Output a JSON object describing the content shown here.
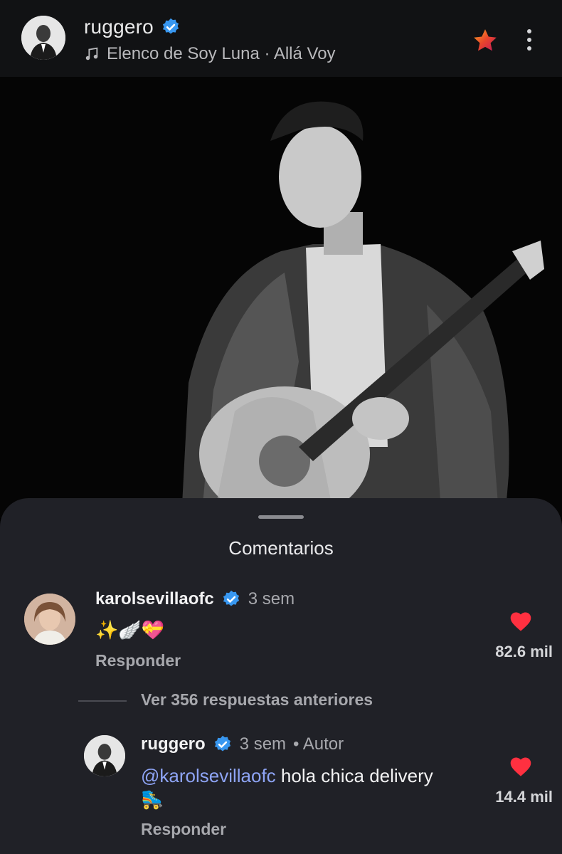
{
  "header": {
    "username": "ruggero",
    "song": "Elenco de Soy Luna · Allá Voy"
  },
  "sheet": {
    "title": "Comentarios"
  },
  "comments": [
    {
      "username": "karolsevillaofc",
      "time": "3 sem",
      "text": "✨🪽💝",
      "reply_label": "Responder",
      "likes": "82.6 mil"
    }
  ],
  "view_more": "Ver 356 respuestas anteriores",
  "reply": {
    "username": "ruggero",
    "time": "3 sem",
    "author_tag": "• Autor",
    "mention": "@karolsevillaofc",
    "text": " hola chica delivery",
    "emoji": "🛼",
    "reply_label": "Responder",
    "likes": "14.4 mil"
  },
  "colors": {
    "accent_blue": "#3897f0",
    "heart_red": "#ff3040",
    "mention": "#8ea4f5"
  }
}
